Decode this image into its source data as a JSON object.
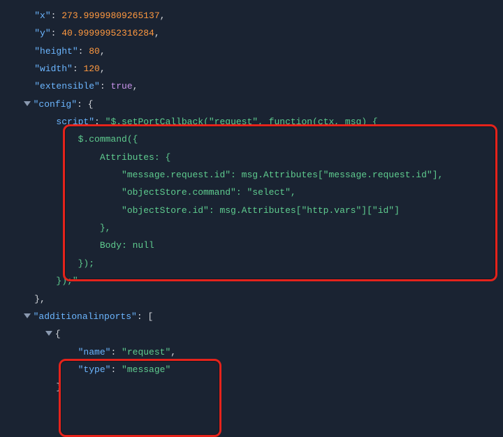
{
  "props": {
    "x": {
      "key": "\"x\"",
      "val": "273.99999809265137"
    },
    "y": {
      "key": "\"y\"",
      "val": "40.99999952316284"
    },
    "height": {
      "key": "\"height\"",
      "val": "80"
    },
    "width": {
      "key": "\"width\"",
      "val": "120"
    },
    "extensible": {
      "key": "\"extensible\"",
      "val": "true"
    },
    "config": {
      "key": "\"config\""
    },
    "script": {
      "key": "script\"",
      "head": "\"$.setPortCallback(\"request\", function(ctx, msg) {",
      "l1": "$.command({",
      "l2": "Attributes: {",
      "l3": "\"message.request.id\": msg.Attributes[\"message.request.id\"],",
      "l4": "\"objectStore.command\": \"select\",",
      "l5": "\"objectStore.id\": msg.Attributes[\"http.vars\"][\"id\"]",
      "l6": "},",
      "l7": "Body: null",
      "l8": "});",
      "l9": "});\""
    },
    "additionalinports": {
      "key": "\"additionalinports\""
    },
    "port": {
      "name": {
        "key": "\"name\"",
        "val": "\"request\""
      },
      "type": {
        "key": "\"type\"",
        "val": "\"message\""
      }
    }
  }
}
